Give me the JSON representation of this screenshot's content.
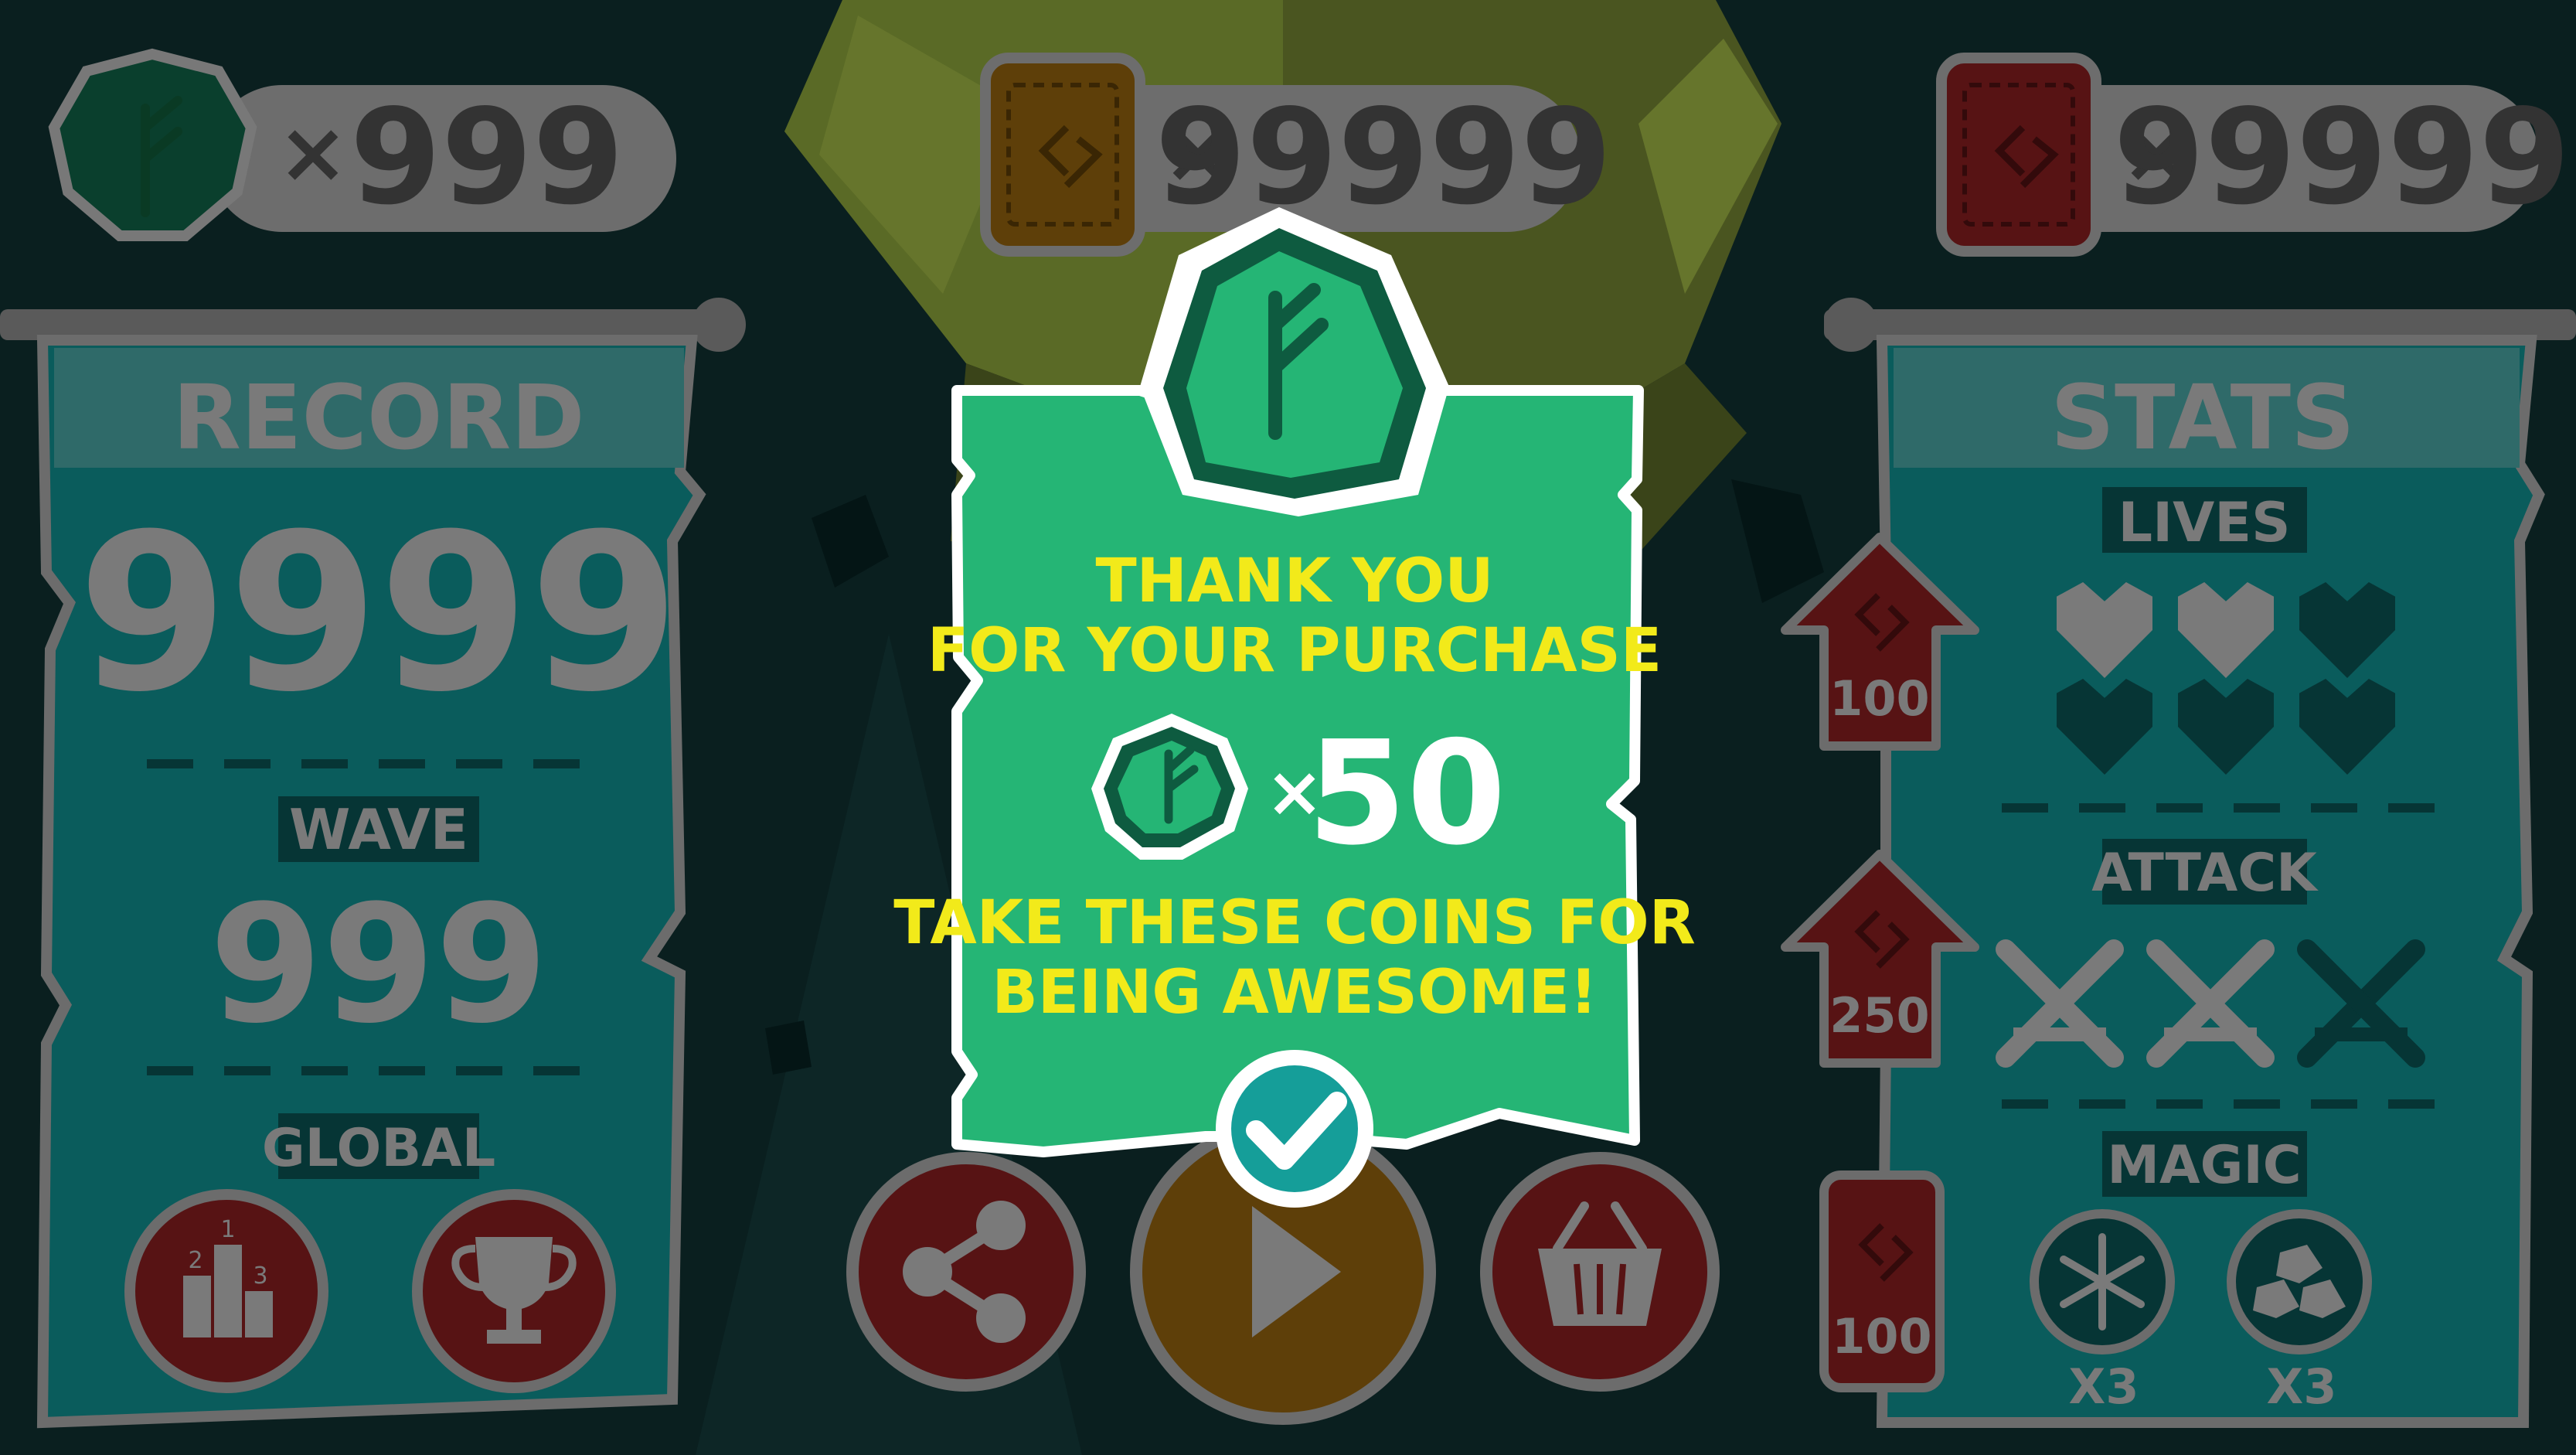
{
  "currencies": {
    "coins": {
      "icon": "rune-coin-icon",
      "times": "×",
      "value": "999"
    },
    "gold_tickets": {
      "icon": "gold-ticket-icon",
      "times": "×",
      "value": "99999"
    },
    "red_tickets": {
      "icon": "red-ticket-icon",
      "times": "×",
      "value": "99999"
    }
  },
  "record_panel": {
    "title": "RECORD",
    "score": "9999",
    "wave_label": "WAVE",
    "wave_value": "999",
    "global_label": "GLOBAL",
    "buttons": [
      {
        "name": "leaderboard-button",
        "icon": "podium-icon",
        "podium_labels": [
          "1",
          "2",
          "3"
        ]
      },
      {
        "name": "achievements-button",
        "icon": "trophy-icon"
      }
    ]
  },
  "stats_panel": {
    "title": "STATS",
    "lives_label": "LIVES",
    "lives": {
      "filled": 2,
      "total": 6
    },
    "attack_label": "ATTACK",
    "attack": {
      "filled": 2,
      "total": 3
    },
    "magic_label": "MAGIC",
    "magic": [
      {
        "icon": "snowflake-icon",
        "count": "X3"
      },
      {
        "icon": "rocks-icon",
        "count": "X3"
      }
    ],
    "upgrades": [
      {
        "name": "upgrade-lives-button",
        "cost": "100"
      },
      {
        "name": "upgrade-attack-button",
        "cost": "250"
      },
      {
        "name": "buy-magic-button",
        "cost": "100"
      }
    ]
  },
  "bottom_buttons": [
    {
      "name": "share-button",
      "icon": "share-icon"
    },
    {
      "name": "play-button",
      "icon": "play-icon"
    },
    {
      "name": "shop-button",
      "icon": "basket-icon"
    }
  ],
  "dialog": {
    "line1": "THANK YOU",
    "line2": "FOR YOUR PURCHASE",
    "reward_icon": "rune-coin-icon",
    "reward_times": "×",
    "reward_amount": "50",
    "message_line1": "TAKE THESE COINS FOR",
    "message_line2": "BEING AWESOME!",
    "confirm_icon": "checkmark-icon"
  },
  "colors": {
    "background": "#0b2020",
    "panel_teal": "#0a5c5c",
    "dialog_green": "#25b575",
    "dialog_text": "#f2ea1a",
    "button_red": "#7a1618",
    "play_orange": "#7a4a0c",
    "check_teal": "#159e99"
  }
}
